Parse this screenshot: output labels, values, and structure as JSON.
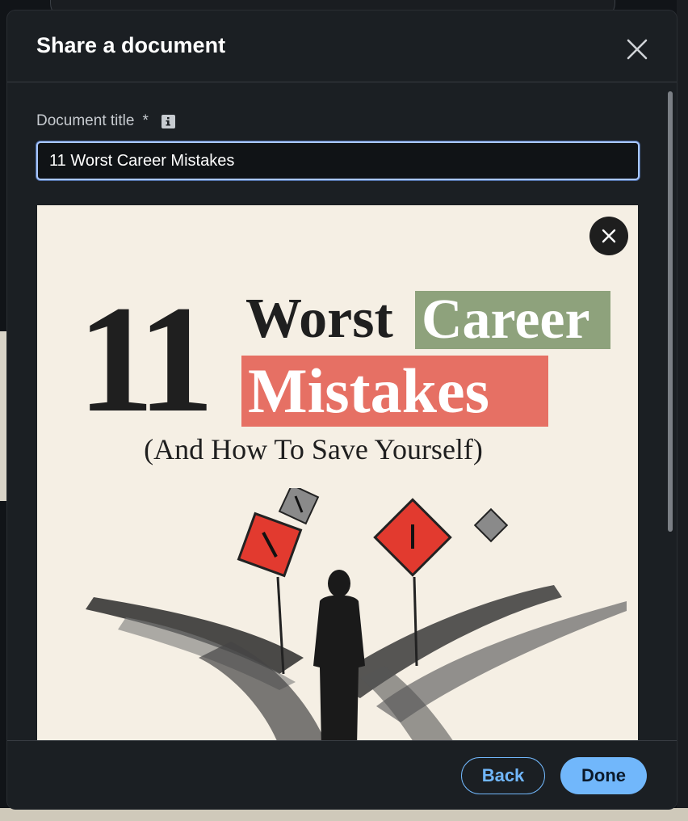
{
  "dialog": {
    "title": "Share a document",
    "close_icon": "close-icon"
  },
  "form": {
    "title_label": "Document title",
    "required_mark": "*",
    "info_icon": "info-icon",
    "title_value": "11 Worst Career Mistakes"
  },
  "preview": {
    "remove_icon": "close-icon",
    "number": "11",
    "word1": "Worst",
    "word2": "Career",
    "word3": "Mistakes",
    "subtitle": "(And How To Save Yourself)",
    "colors": {
      "background": "#f5efe4",
      "career_highlight": "#8ea27c",
      "mistakes_highlight": "#e67064",
      "text": "#1f1f1f"
    }
  },
  "footer": {
    "back_label": "Back",
    "done_label": "Done",
    "accent": "#71b7fb"
  }
}
